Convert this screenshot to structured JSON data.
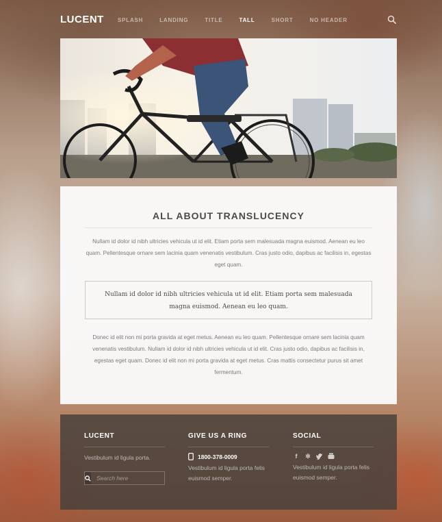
{
  "nav": {
    "brand": "LUCENT",
    "items": [
      "SPLASH",
      "LANDING",
      "TITLE",
      "TALL",
      "SHORT",
      "NO HEADER"
    ],
    "active_index": 3,
    "search_icon": "search-icon"
  },
  "content": {
    "title": "ALL ABOUT TRANSLUCENCY",
    "intro": "Nullam id dolor id nibh ultricies vehicula ut id elit. Etiam porta sem malesuada magna euismod. Aenean eu leo quam. Pellentesque ornare sem lacinia quam venenatis vestibulum. Cras justo odio, dapibus ac facilisis in, egestas eget quam.",
    "quote": "Nullam id dolor id nibh ultricies vehicula ut id elit. Etiam porta sem malesuada magna euismod. Aenean eu leo quam.",
    "body": "Donec id elit non mi porta gravida at eget metus. Aenean eu leo quam. Pellentesque ornare sem lacinia quam venenatis vestibulum. Nullam id dolor id nibh ultricies vehicula ut id elit. Cras justo odio, dapibus ac facilisis in, egestas eget quam. Donec id elit non mi porta gravida at eget metus. Cras mattis consectetur purus sit amet fermentum."
  },
  "footer": {
    "col1": {
      "title": "LUCENT",
      "text": "Vestibulum id ligula porta.",
      "search_placeholder": "Search here"
    },
    "col2": {
      "title": "GIVE US A RING",
      "phone": "1800-378-0009",
      "text": "Vestibulum id ligula porta felis euismod semper."
    },
    "col3": {
      "title": "SOCIAL",
      "icons": [
        "facebook-icon",
        "yelp-icon",
        "twitter-icon",
        "youtube-icon"
      ],
      "text": "Vestibulum id ligula porta felis euismod semper."
    }
  },
  "colors": {
    "card_bg": "#fafafa",
    "footer_bg": "#46403a",
    "heading": "#4a4a4a",
    "body_text": "#7a7a7a"
  }
}
